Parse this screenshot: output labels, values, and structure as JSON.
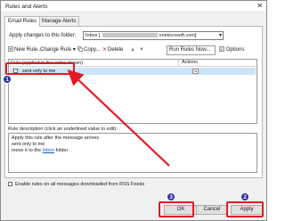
{
  "window": {
    "title": "Rules and Alerts",
    "close_glyph": "✕"
  },
  "tabs": [
    {
      "label": "Email Rules"
    },
    {
      "label": "Manage Alerts"
    }
  ],
  "apply_row": {
    "label": "Apply changes to this folder:",
    "folder_prefix": "Inbox [",
    "folder_suffix": "onmicrosoft.com]"
  },
  "toolbar": {
    "new_rule": "New Rule...",
    "change_rule": "Change Rule ▾",
    "copy": "Copy...",
    "delete": "Delete",
    "run_rules_now": "Run Rules Now...",
    "options": "Options"
  },
  "grid": {
    "col_rule": "Rule (applied in the order shown)",
    "col_actions": "Actions",
    "rows": [
      {
        "name": "sent only to me",
        "checked": false
      }
    ]
  },
  "description": {
    "label": "Rule description (click an underlined value to edit):",
    "line1": "Apply this rule after the message arrives",
    "line2": "sent only to me",
    "line3_pre": "move it to the ",
    "line3_link": "Inbox",
    "line3_post": " folder"
  },
  "rss": {
    "label": "Enable rules on all messages downloaded from RSS Feeds",
    "checked": false
  },
  "buttons": {
    "ok": "OK",
    "cancel": "Cancel",
    "apply": "Apply"
  },
  "annotations": {
    "step1": "1",
    "step2": "2",
    "step3": "3",
    "color": "#e21b23",
    "badge_color": "#2a2fa0"
  }
}
